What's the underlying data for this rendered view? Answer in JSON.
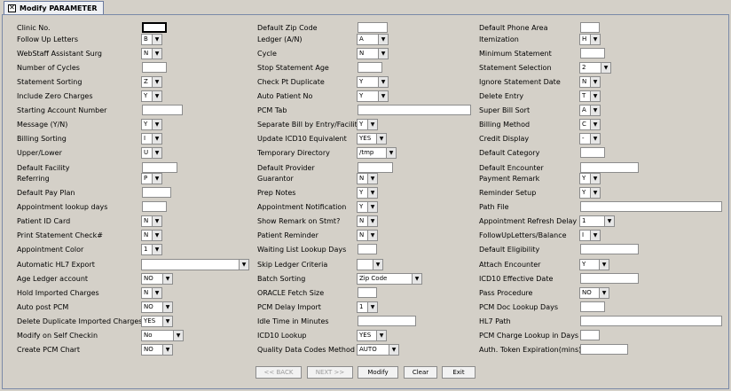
{
  "window": {
    "tab_title": "Modify PARAMETER"
  },
  "fields": [
    {
      "id": "clinic-no",
      "label": "Clinic No.",
      "type": "text",
      "value": ""
    },
    {
      "id": "default-zip-code",
      "label": "Default Zip Code",
      "type": "text",
      "value": ""
    },
    {
      "id": "default-phone-area",
      "label": "Default Phone Area",
      "type": "text",
      "value": ""
    },
    {
      "id": "follow-up-letters",
      "label": "Follow Up Letters",
      "type": "select",
      "value": "B"
    },
    {
      "id": "ledger-an",
      "label": "Ledger (A/N)",
      "type": "select",
      "value": "A"
    },
    {
      "id": "itemization",
      "label": "Itemization",
      "type": "select",
      "value": "H"
    },
    {
      "id": "webstaff-assistant-surg",
      "label": "WebStaff Assistant Surg",
      "type": "select",
      "value": "N"
    },
    {
      "id": "cycle",
      "label": "Cycle",
      "type": "select",
      "value": "N"
    },
    {
      "id": "minimum-statement",
      "label": "Minimum Statement",
      "type": "text",
      "value": ""
    },
    {
      "id": "number-of-cycles",
      "label": "Number of Cycles",
      "type": "text",
      "value": ""
    },
    {
      "id": "stop-statement-age",
      "label": "Stop Statement Age",
      "type": "text",
      "value": ""
    },
    {
      "id": "statement-selection",
      "label": "Statement Selection",
      "type": "select",
      "value": "2"
    },
    {
      "id": "statement-sorting",
      "label": "Statement Sorting",
      "type": "select",
      "value": "Z"
    },
    {
      "id": "check-pt-duplicate",
      "label": "Check Pt Duplicate",
      "type": "select",
      "value": "Y"
    },
    {
      "id": "ignore-statement-date",
      "label": "Ignore Statement Date",
      "type": "select",
      "value": "N"
    },
    {
      "id": "include-zero-charges",
      "label": "Include Zero Charges",
      "type": "select",
      "value": "Y"
    },
    {
      "id": "auto-patient-no",
      "label": "Auto Patient No",
      "type": "select",
      "value": "Y"
    },
    {
      "id": "delete-entry",
      "label": "Delete Entry",
      "type": "select",
      "value": "T"
    },
    {
      "id": "starting-account-number",
      "label": "Starting Account Number",
      "type": "text",
      "value": ""
    },
    {
      "id": "pcm-tab",
      "label": "PCM Tab",
      "type": "text",
      "value": ""
    },
    {
      "id": "super-bill-sort",
      "label": "Super Bill Sort",
      "type": "select",
      "value": "A"
    },
    {
      "id": "message-yn",
      "label": "Message (Y/N)",
      "type": "select",
      "value": "Y"
    },
    {
      "id": "separate-bill",
      "label": "Separate Bill by Entry/Facility",
      "type": "select",
      "value": "Y"
    },
    {
      "id": "billing-method",
      "label": "Billing Method",
      "type": "select",
      "value": "C"
    },
    {
      "id": "billing-sorting",
      "label": "Billing Sorting",
      "type": "select",
      "value": "I"
    },
    {
      "id": "update-icd10",
      "label": "Update ICD10 Equivalent",
      "type": "select",
      "value": "YES"
    },
    {
      "id": "credit-display",
      "label": "Credit Display",
      "type": "select",
      "value": "-"
    },
    {
      "id": "upper-lower",
      "label": "Upper/Lower",
      "type": "select",
      "value": "U"
    },
    {
      "id": "temporary-directory",
      "label": "Temporary Directory",
      "type": "select",
      "value": "/tmp"
    },
    {
      "id": "default-category",
      "label": "Default Category",
      "type": "text",
      "value": ""
    },
    {
      "id": "default-facility",
      "label": "Default Facility",
      "type": "text",
      "value": ""
    },
    {
      "id": "default-provider",
      "label": "Default Provider",
      "type": "text",
      "value": ""
    },
    {
      "id": "default-encounter",
      "label": "Default Encounter",
      "type": "text",
      "value": ""
    },
    {
      "id": "referring",
      "label": "Referring",
      "type": "select",
      "value": "P"
    },
    {
      "id": "guarantor",
      "label": "Guarantor",
      "type": "select",
      "value": "N"
    },
    {
      "id": "payment-remark",
      "label": "Payment Remark",
      "type": "select",
      "value": "Y"
    },
    {
      "id": "default-pay-plan",
      "label": "Default Pay Plan",
      "type": "text",
      "value": ""
    },
    {
      "id": "prep-notes",
      "label": "Prep Notes",
      "type": "select",
      "value": "Y"
    },
    {
      "id": "reminder-setup",
      "label": "Reminder Setup",
      "type": "select",
      "value": "Y"
    },
    {
      "id": "appointment-lookup-days",
      "label": "Appointment lookup days",
      "type": "text",
      "value": ""
    },
    {
      "id": "appointment-notification",
      "label": "Appointment Notification",
      "type": "select",
      "value": "Y"
    },
    {
      "id": "path-file",
      "label": "Path File",
      "type": "text",
      "value": ""
    },
    {
      "id": "patient-id-card",
      "label": "Patient ID Card",
      "type": "select",
      "value": "N"
    },
    {
      "id": "show-remark-on-stmt",
      "label": "Show Remark on Stmt?",
      "type": "select",
      "value": "N"
    },
    {
      "id": "appointment-refresh-delay",
      "label": "Appointment Refresh Delay",
      "type": "select",
      "value": "1"
    },
    {
      "id": "print-statement-check",
      "label": "Print Statement Check#",
      "type": "select",
      "value": "N"
    },
    {
      "id": "patient-reminder",
      "label": "Patient Reminder",
      "type": "select",
      "value": "N"
    },
    {
      "id": "followup-letters-balance",
      "label": "FollowUpLetters/Balance",
      "type": "select",
      "value": "I"
    },
    {
      "id": "appointment-color",
      "label": "Appointment Color",
      "type": "select",
      "value": "1"
    },
    {
      "id": "waiting-list-lookup-days",
      "label": "Waiting List Lookup Days",
      "type": "text",
      "value": ""
    },
    {
      "id": "default-eligibility",
      "label": "Default Eligibility",
      "type": "text",
      "value": ""
    },
    {
      "id": "automatic-hl7-export",
      "label": "Automatic HL7 Export",
      "type": "select",
      "value": ""
    },
    {
      "id": "skip-ledger-criteria",
      "label": "Skip Ledger Criteria",
      "type": "select",
      "value": ""
    },
    {
      "id": "attach-encounter",
      "label": "Attach Encounter",
      "type": "select",
      "value": "Y"
    },
    {
      "id": "age-ledger-account",
      "label": "Age Ledger account",
      "type": "select",
      "value": "NO"
    },
    {
      "id": "batch-sorting",
      "label": "Batch Sorting",
      "type": "select",
      "value": "Zip Code"
    },
    {
      "id": "icd10-effective-date",
      "label": "ICD10 Effective Date",
      "type": "text",
      "value": ""
    },
    {
      "id": "hold-imported-charges",
      "label": "Hold Imported Charges",
      "type": "select",
      "value": "N"
    },
    {
      "id": "oracle-fetch-size",
      "label": "ORACLE Fetch Size",
      "type": "text",
      "value": ""
    },
    {
      "id": "pass-procedure",
      "label": "Pass Procedure",
      "type": "select",
      "value": "NO"
    },
    {
      "id": "auto-post-pcm",
      "label": "Auto post PCM",
      "type": "select",
      "value": "NO"
    },
    {
      "id": "pcm-delay-import",
      "label": "PCM Delay Import",
      "type": "select",
      "value": "1"
    },
    {
      "id": "pcm-doc-lookup-days",
      "label": "PCM Doc Lookup Days",
      "type": "text",
      "value": ""
    },
    {
      "id": "delete-duplicate-imported-charges",
      "label": "Delete Duplicate Imported Charges",
      "type": "select",
      "value": "YES"
    },
    {
      "id": "idle-time-in-minutes",
      "label": "Idle Time in Minutes",
      "type": "text",
      "value": ""
    },
    {
      "id": "hl7-path",
      "label": "HL7 Path",
      "type": "text",
      "value": ""
    },
    {
      "id": "modify-on-self-checkin",
      "label": "Modify on Self Checkin",
      "type": "select",
      "value": "No"
    },
    {
      "id": "icd10-lookup",
      "label": "ICD10 Lookup",
      "type": "select",
      "value": "YES"
    },
    {
      "id": "pcm-charge-lookup-in-days",
      "label": "PCM Charge Lookup in Days",
      "type": "text",
      "value": ""
    },
    {
      "id": "create-pcm-chart",
      "label": "Create PCM Chart",
      "type": "select",
      "value": "NO"
    },
    {
      "id": "quality-data-codes-method",
      "label": "Quality Data Codes Method",
      "type": "select",
      "value": "AUTO"
    },
    {
      "id": "auth-token-expiration",
      "label": "Auth. Token Expiration(mins)",
      "type": "text",
      "value": ""
    }
  ],
  "buttons": {
    "back": "<< BACK",
    "next": "NEXT >>",
    "modify": "Modify",
    "clear": "Clear",
    "exit": "Exit"
  }
}
